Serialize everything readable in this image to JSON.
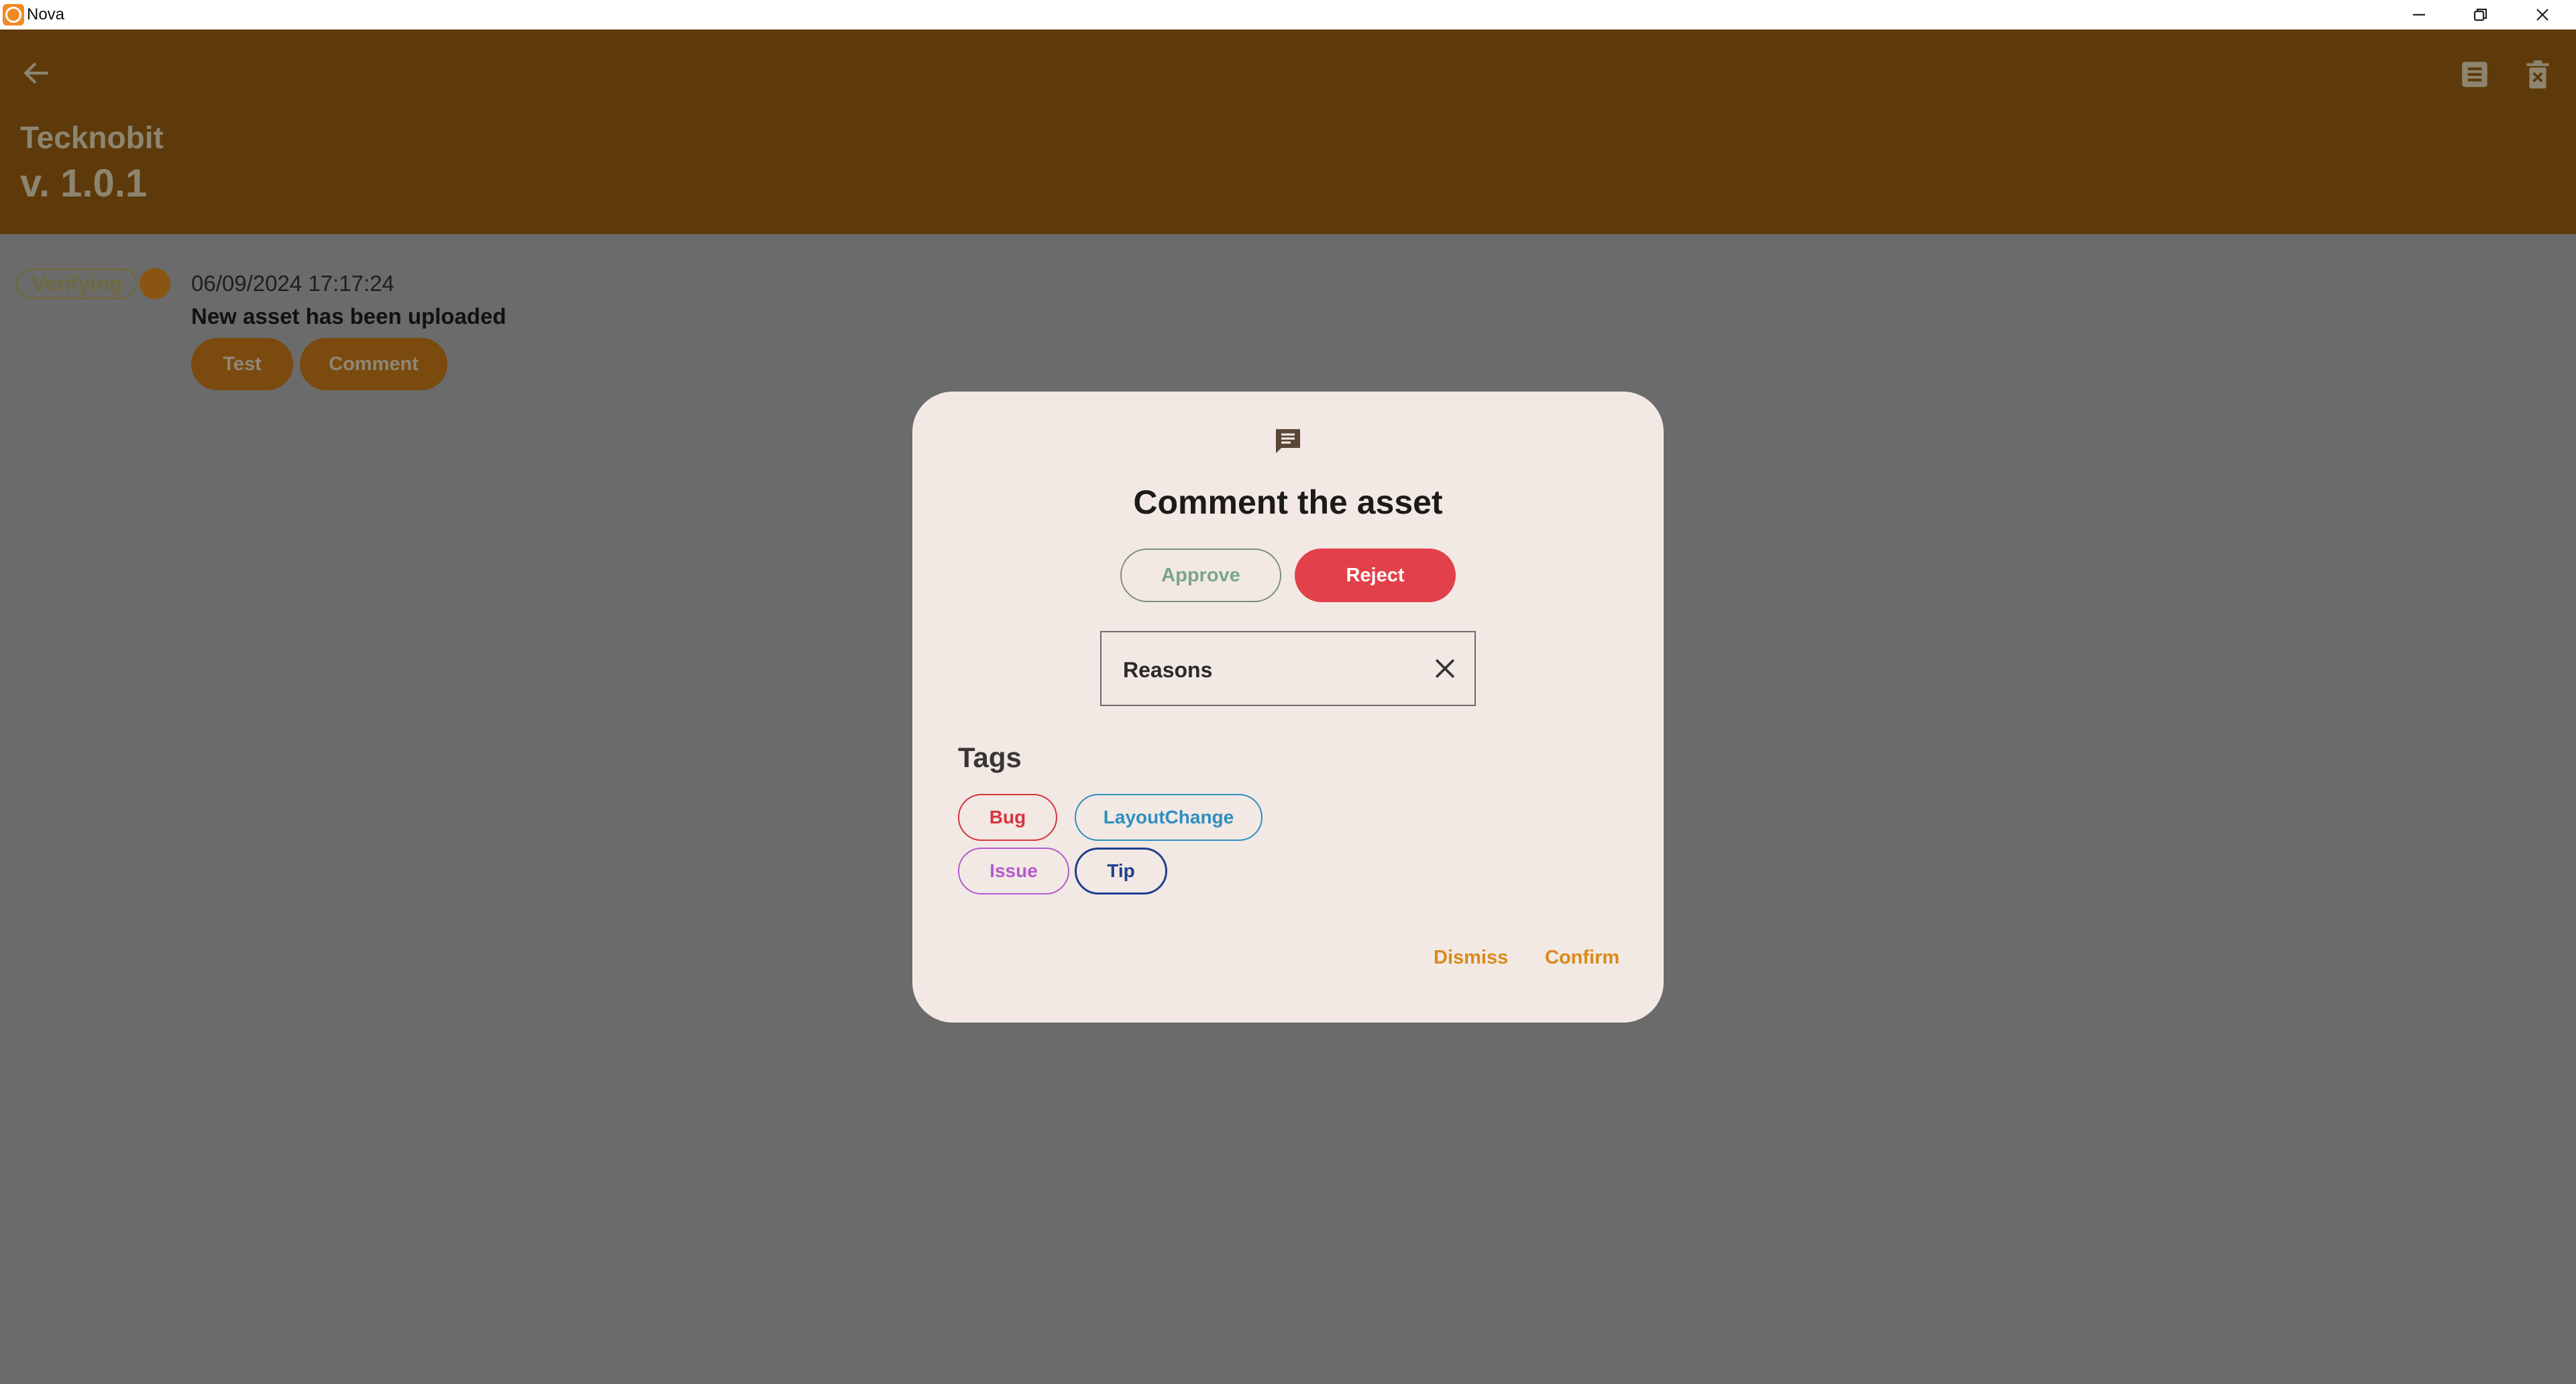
{
  "window": {
    "title": "Nova"
  },
  "appbar": {
    "app_name": "Tecknobit",
    "version": "v. 1.0.1"
  },
  "event": {
    "status": "Verifying",
    "timestamp": "06/09/2024 17:17:24",
    "message": "New asset has been uploaded",
    "actions": [
      "Test",
      "Comment"
    ]
  },
  "dialog": {
    "title": "Comment the asset",
    "approve_label": "Approve",
    "reject_label": "Reject",
    "selected_option": "Reject",
    "reasons_label": "Reasons",
    "tags_title": "Tags",
    "tags": [
      {
        "label": "Bug",
        "color": "#d6343d"
      },
      {
        "label": "LayoutChange",
        "color": "#2d8fbf"
      },
      {
        "label": "Issue",
        "color": "#b55ad0"
      },
      {
        "label": "Tip",
        "color": "#1e3f8f"
      }
    ],
    "dismiss_label": "Dismiss",
    "confirm_label": "Confirm"
  },
  "colors": {
    "appbar": "#5e3a0b",
    "scrim": "#6a6b6a",
    "dialog_bg": "#f2e8e4",
    "reject": "#e2404a",
    "accent": "#d98a1a"
  }
}
